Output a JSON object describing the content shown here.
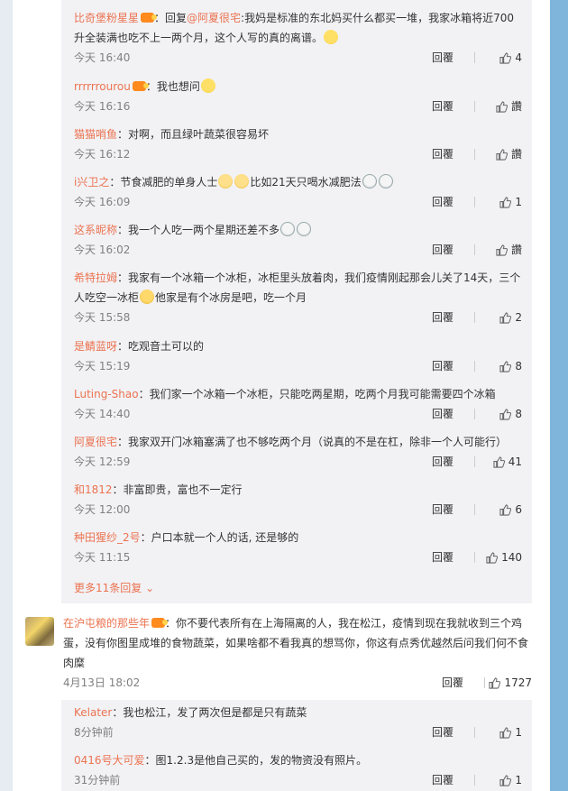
{
  "sub_replies": [
    {
      "user": "比奇堡粉星星",
      "vip": true,
      "segments": [
        {
          "t": "：回复"
        },
        {
          "at": "@阿夏很宅"
        },
        {
          "t": ":我妈是标准的东北妈买什么都买一堆，我家冰箱将近700升全装满也吃不上一两个月，这个人写的真的离谱。"
        }
      ],
      "emoji": [
        "laugh-emoji"
      ],
      "time": "今天 16:40",
      "reply": "回覆",
      "likes": "4"
    },
    {
      "user": "rrrrrrourou",
      "vip": true,
      "segments": [
        {
          "t": "：我也想问"
        }
      ],
      "emoji": [
        "laugh-emoji"
      ],
      "time": "今天 16:16",
      "reply": "回覆",
      "likes": "讚"
    },
    {
      "user": "猫猫哨鱼",
      "vip": false,
      "segments": [
        {
          "t": "：对啊，而且绿叶蔬菜很容易坏"
        }
      ],
      "emoji": [],
      "time": "今天 16:12",
      "reply": "回覆",
      "likes": "讚"
    },
    {
      "user": "i兴卫之",
      "vip": false,
      "segments": [
        {
          "t": "：节食减肥的单身人士"
        }
      ],
      "emoji_mid": [
        "doge-emoji",
        "doge-emoji"
      ],
      "segments2": [
        {
          "t": "比如21天只喝水减肥法"
        }
      ],
      "emoji": [
        "sad-emoji",
        "sad-emoji"
      ],
      "time": "今天 16:09",
      "reply": "回覆",
      "likes": "1"
    },
    {
      "user": "这系昵称",
      "vip": false,
      "segments": [
        {
          "t": "：我一个人吃一两个星期还差不多"
        }
      ],
      "emoji": [
        "sad-emoji",
        "sad-emoji"
      ],
      "time": "今天 16:02",
      "reply": "回覆",
      "likes": "讚"
    },
    {
      "user": "希特拉姆",
      "vip": false,
      "segments": [
        {
          "t": "：我家有一个冰箱一个冰柜，冰柜里头放着肉，我们疫情刚起那会儿关了14天，三个人吃空一冰柜"
        }
      ],
      "emoji_mid": [
        "cat-emoji"
      ],
      "segments2": [
        {
          "t": "他家是有个冰房是吧，吃一个月"
        }
      ],
      "emoji": [],
      "time": "今天 15:58",
      "reply": "回覆",
      "likes": "2"
    },
    {
      "user": "是鲭蓝呀",
      "vip": false,
      "segments": [
        {
          "t": "：吃观音土可以的"
        }
      ],
      "emoji": [],
      "time": "今天 15:19",
      "reply": "回覆",
      "likes": "8"
    },
    {
      "user": "Luting-Shao",
      "vip": false,
      "segments": [
        {
          "t": "：我们家一个冰箱一个冰柜，只能吃两星期，吃两个月我可能需要四个冰箱"
        }
      ],
      "emoji": [],
      "time": "今天 14:40",
      "reply": "回覆",
      "likes": "8"
    },
    {
      "user": "阿夏很宅",
      "vip": false,
      "segments": [
        {
          "t": "：我家双开门冰箱塞满了也不够吃两个月（说真的不是在杠，除非一个人可能行）"
        }
      ],
      "emoji": [],
      "time": "今天 12:59",
      "reply": "回覆",
      "likes": "41"
    },
    {
      "user": "和1812",
      "vip": false,
      "segments": [
        {
          "t": "：非富即贵，富也不一定行"
        }
      ],
      "emoji": [],
      "time": "今天 12:00",
      "reply": "回覆",
      "likes": "6"
    },
    {
      "user": "种田猩纱_2号",
      "vip": false,
      "segments": [
        {
          "t": "：户口本就一个人的话, 还是够的"
        }
      ],
      "emoji": [],
      "time": "今天 11:15",
      "reply": "回覆",
      "likes": "140"
    }
  ],
  "more_replies": "更多11条回复",
  "main_comment": {
    "user": "在沪屯粮的那些年",
    "vip": true,
    "text": "：你不要代表所有在上海隔离的人，我在松江，疫情到现在我就收到三个鸡蛋，没有你图里成堆的食物蔬菜，如果啥都不看我真的想骂你，你这有点秀优越然后问我们何不食肉糜",
    "time": "4月13日 18:02",
    "reply": "回覆",
    "likes": "1727"
  },
  "main_sub_replies": [
    {
      "user": "Kelater",
      "segments": [
        {
          "t": "：我也松江，发了两次但是都是只有蔬菜"
        }
      ],
      "time": "8分钟前",
      "reply": "回覆",
      "likes": "1"
    },
    {
      "user": "0416号大可爱",
      "segments": [
        {
          "t": "：图1.2.3是他自己买的，发的物资没有照片。"
        }
      ],
      "time": "31分钟前",
      "reply": "回覆",
      "likes": "1"
    }
  ]
}
